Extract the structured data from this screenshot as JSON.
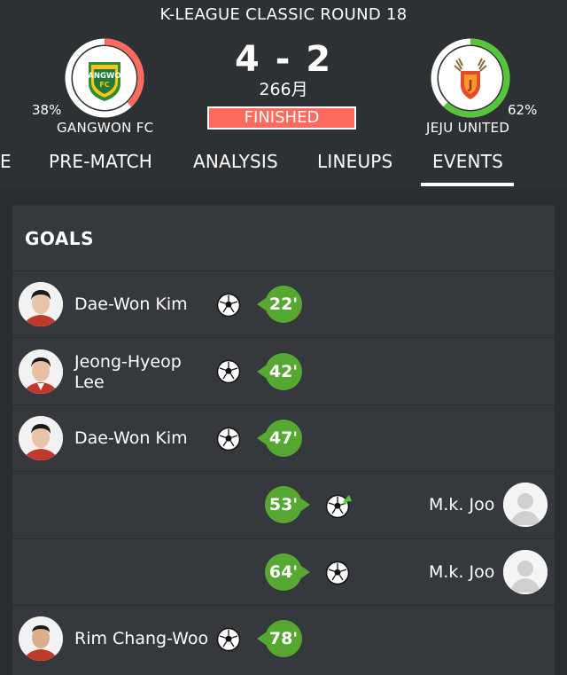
{
  "header": {
    "league_round": "K-LEAGUE CLASSIC ROUND 18",
    "score": "4 - 2",
    "attendance": "266月",
    "status": "FINISHED",
    "home": {
      "name": "GANGWON FC",
      "pct": "38%",
      "pct_value": 38,
      "ring_color": "#ff6a5f",
      "logo_text_top": "GANGWON",
      "logo_text_bottom": "FC"
    },
    "away": {
      "name": "JEJU UNITED",
      "pct": "62%",
      "pct_value": 62,
      "ring_color": "#57c53a"
    }
  },
  "tabs": [
    {
      "label": "E"
    },
    {
      "label": "PRE-MATCH"
    },
    {
      "label": "ANALYSIS"
    },
    {
      "label": "LINEUPS"
    },
    {
      "label": "EVENTS",
      "active": true
    }
  ],
  "goals": {
    "title": "GOALS",
    "events": [
      {
        "team": "home",
        "player": "Dae-Won Kim",
        "minute": "22'",
        "icon": "soccer-ball-icon"
      },
      {
        "team": "home",
        "player": "Jeong-Hyeop Lee",
        "minute": "42'",
        "icon": "soccer-ball-icon"
      },
      {
        "team": "home",
        "player": "Dae-Won Kim",
        "minute": "47'",
        "icon": "soccer-ball-icon"
      },
      {
        "team": "away",
        "player": "M.k. Joo",
        "minute": "53'",
        "icon": "penalty-goal-icon"
      },
      {
        "team": "away",
        "player": "M.k. Joo",
        "minute": "64'",
        "icon": "soccer-ball-icon"
      },
      {
        "team": "home",
        "player": "Rim Chang-Woo",
        "minute": "78'",
        "icon": "soccer-ball-icon"
      }
    ]
  },
  "colors": {
    "background": "#2b2e31",
    "card": "#35383c",
    "accent_green": "#57a832",
    "status_red": "#ff6a5f"
  }
}
